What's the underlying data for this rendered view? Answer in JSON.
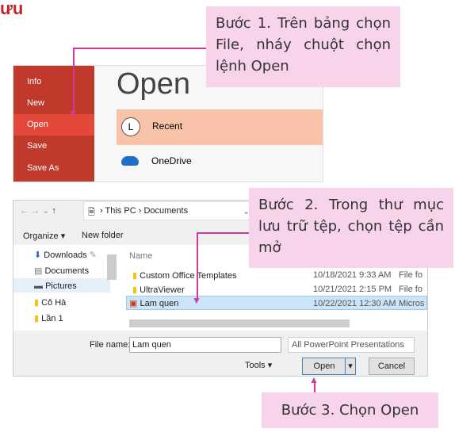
{
  "heading": "ưu",
  "callouts": {
    "step1": "Bước 1. Trên bảng chọn File, nháy chuột chọn lệnh Open",
    "step2": "Bước 2. Trong thư mục lưu trữ tệp, chọn tệp cần mở",
    "step3": "Bước 3. Chọn Open"
  },
  "backstage": {
    "menu": [
      "Info",
      "New",
      "Open",
      "Save",
      "Save As"
    ],
    "selected": "Open",
    "title": "Open",
    "locations": [
      "Recent",
      "OneDrive"
    ]
  },
  "dialog": {
    "breadcrumb": [
      "This PC",
      "Documents"
    ],
    "toolbar": {
      "organize": "Organize ▾",
      "new_folder": "New folder"
    },
    "nav": [
      "Downloads",
      "Documents",
      "Pictures",
      "Cô Hà",
      "Lần 1"
    ],
    "column": "Name",
    "files": [
      {
        "name": "Custom Office Templates",
        "date": "10/18/2021 9:33 AM",
        "type": "File fo"
      },
      {
        "name": "UltraViewer",
        "date": "10/21/2021 2:15 PM",
        "type": "File fo"
      },
      {
        "name": "Lam quen",
        "date": "10/22/2021 12:30 AM",
        "type": "Micros"
      }
    ],
    "file_name_label": "File name:",
    "file_name_value": "Lam quen",
    "filter": "All PowerPoint Presentations",
    "tools": "Tools",
    "open": "Open",
    "cancel": "Cancel"
  },
  "colors": {
    "accent": "#c1392b",
    "callout": "#f8d4ec",
    "arrow": "#d6379b"
  }
}
